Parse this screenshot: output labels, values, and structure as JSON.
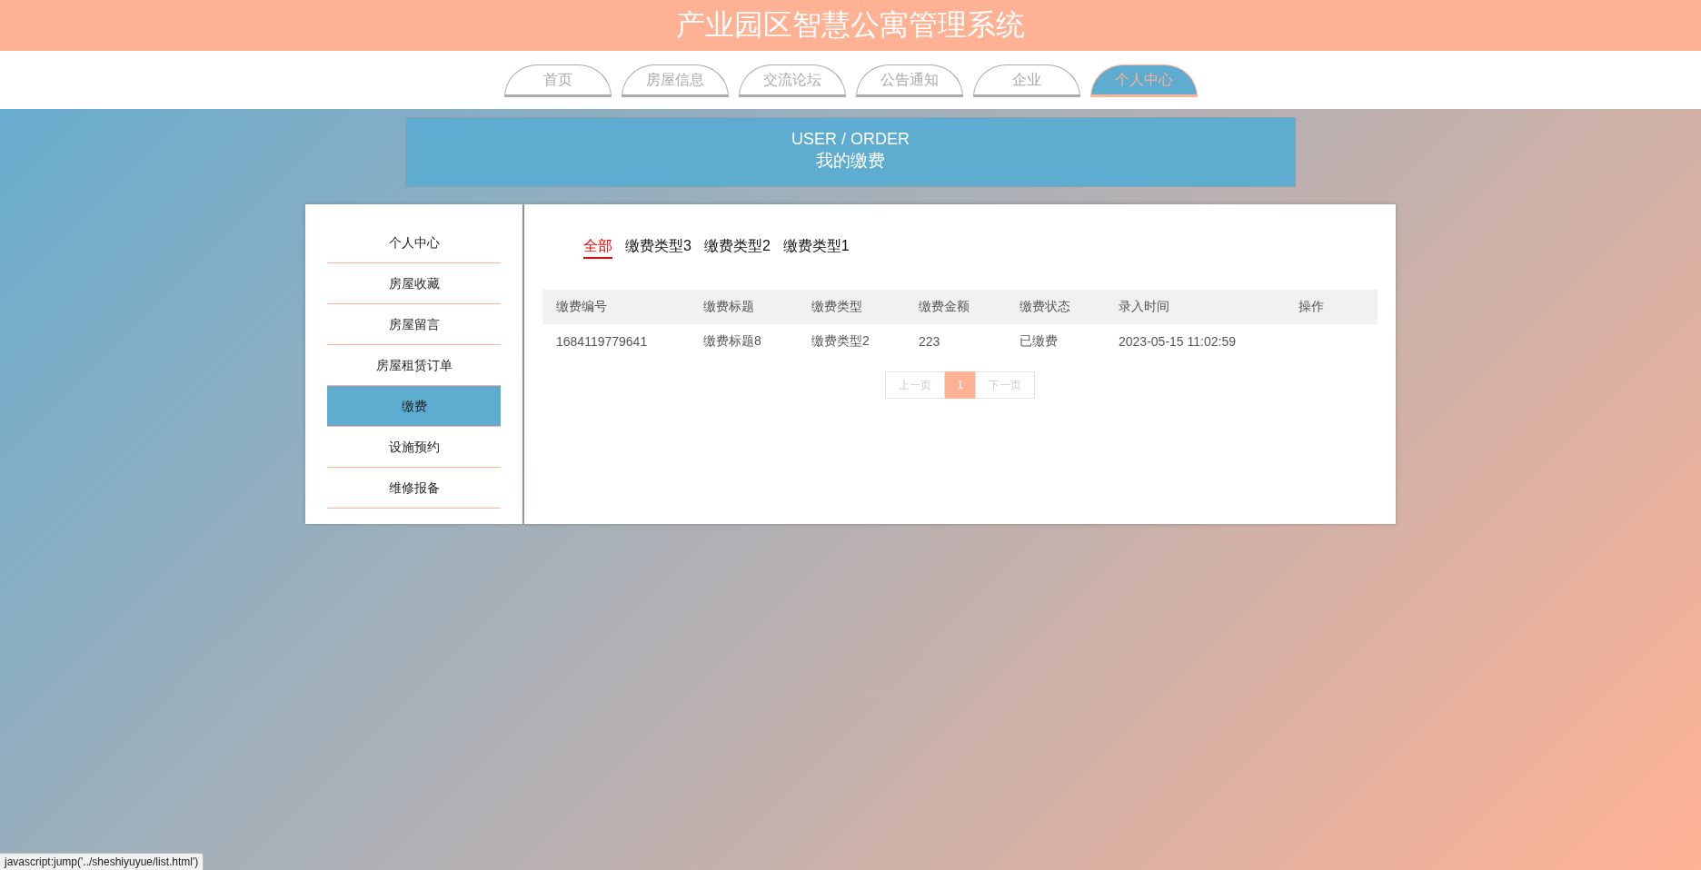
{
  "header": {
    "title": "产业园区智慧公寓管理系统"
  },
  "nav": [
    {
      "label": "首页",
      "selected": false
    },
    {
      "label": "房屋信息",
      "selected": false
    },
    {
      "label": "交流论坛",
      "selected": false
    },
    {
      "label": "公告通知",
      "selected": false
    },
    {
      "label": "企业",
      "selected": false
    },
    {
      "label": "个人中心",
      "selected": true
    }
  ],
  "banner": {
    "subtitle": "USER / ORDER",
    "title": "我的缴费"
  },
  "sidebar": {
    "items": [
      {
        "label": "个人中心",
        "selected": false
      },
      {
        "label": "房屋收藏",
        "selected": false
      },
      {
        "label": "房屋留言",
        "selected": false
      },
      {
        "label": "房屋租赁订单",
        "selected": false
      },
      {
        "label": "缴费",
        "selected": true
      },
      {
        "label": "设施预约",
        "selected": false
      },
      {
        "label": "维修报备",
        "selected": false
      }
    ]
  },
  "filters": [
    {
      "label": "全部",
      "selected": true
    },
    {
      "label": "缴费类型3",
      "selected": false
    },
    {
      "label": "缴费类型2",
      "selected": false
    },
    {
      "label": "缴费类型1",
      "selected": false
    }
  ],
  "table": {
    "columns": [
      "缴费编号",
      "缴费标题",
      "缴费类型",
      "缴费金额",
      "缴费状态",
      "录入时间",
      "操作"
    ],
    "rows": [
      [
        "1684119779641",
        "缴费标题8",
        "缴费类型2",
        "223",
        "已缴费",
        "2023-05-15 11:02:59",
        ""
      ]
    ]
  },
  "pagination": {
    "prev": "上一页",
    "pages": [
      {
        "label": "1",
        "selected": true
      }
    ],
    "next": "下一页"
  },
  "status_bar": {
    "text": "javascript:jump('../sheshiyuyue/list.html')"
  }
}
